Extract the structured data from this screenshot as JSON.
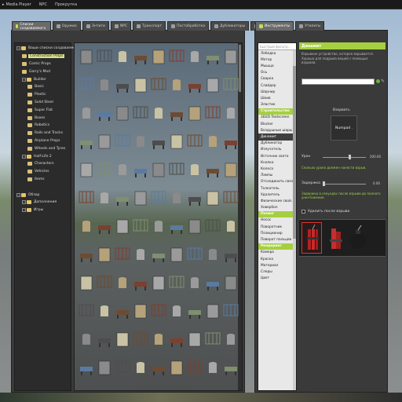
{
  "menubar": {
    "items": [
      "Media Player",
      "NPC",
      "Прокрутка"
    ]
  },
  "spawn_tabs": [
    {
      "label": "Списки создаваемого",
      "active": true
    },
    {
      "label": "Оружие",
      "active": false
    },
    {
      "label": "Энтити",
      "active": false
    },
    {
      "label": "NPC",
      "active": false
    },
    {
      "label": "Транспорт",
      "active": false
    },
    {
      "label": "Постобработка",
      "active": false
    },
    {
      "label": "Дубликаторы",
      "active": false
    },
    {
      "label": "Сохранения",
      "active": false
    }
  ],
  "tree": [
    {
      "label": "Ваши списки создаваемого",
      "indent": 0,
      "type": "folder"
    },
    {
      "label": "Construction Props",
      "indent": 1,
      "type": "file",
      "selected": true
    },
    {
      "label": "Comic Props",
      "indent": 1,
      "type": "file"
    },
    {
      "label": "Garry's Mod",
      "indent": 1,
      "type": "file"
    },
    {
      "label": "Builder",
      "indent": 1,
      "type": "folder"
    },
    {
      "label": "Basic",
      "indent": 2,
      "type": "file"
    },
    {
      "label": "Plastic",
      "indent": 2,
      "type": "file"
    },
    {
      "label": "Solid Steel",
      "indent": 2,
      "type": "file"
    },
    {
      "label": "Super Flat",
      "indent": 2,
      "type": "file"
    },
    {
      "label": "Boxes",
      "indent": 2,
      "type": "file"
    },
    {
      "label": "Robotics",
      "indent": 2,
      "type": "file"
    },
    {
      "label": "Rails and Tracks",
      "indent": 2,
      "type": "file"
    },
    {
      "label": "Airplane Props",
      "indent": 2,
      "type": "file"
    },
    {
      "label": "Wheels and Tyres",
      "indent": 2,
      "type": "file"
    },
    {
      "label": "Half-Life 2",
      "indent": 1,
      "type": "folder"
    },
    {
      "label": "Characters",
      "indent": 2,
      "type": "file"
    },
    {
      "label": "Vehicles",
      "indent": 2,
      "type": "file"
    },
    {
      "label": "Items",
      "indent": 2,
      "type": "file"
    },
    {
      "label": "",
      "indent": 0,
      "type": "blank"
    },
    {
      "label": "Обзор",
      "indent": 0,
      "type": "folder"
    },
    {
      "label": "Дополнения",
      "indent": 1,
      "type": "folder"
    },
    {
      "label": "Игры",
      "indent": 1,
      "type": "folder"
    }
  ],
  "tools_tabs": [
    {
      "label": "Инструменты",
      "active": true
    },
    {
      "label": "Утилиты",
      "active": false
    }
  ],
  "tool_search_placeholder": "Быстрый фильтр...",
  "tools": [
    {
      "label": "Лебедка",
      "kind": "item"
    },
    {
      "label": "Мотор",
      "kind": "item"
    },
    {
      "label": "Мышца",
      "kind": "item"
    },
    {
      "label": "Ось",
      "kind": "item"
    },
    {
      "label": "Сварка",
      "kind": "item"
    },
    {
      "label": "Слайдер",
      "kind": "item"
    },
    {
      "label": "Шарнир",
      "kind": "item"
    },
    {
      "label": "Шкив",
      "kind": "item"
    },
    {
      "label": "Эластик",
      "kind": "item"
    },
    {
      "label": "Строительство",
      "kind": "cat"
    },
    {
      "label": "3D2D Textscreen",
      "kind": "item"
    },
    {
      "label": "Blocker",
      "kind": "item"
    },
    {
      "label": "Воздушные шары",
      "kind": "item"
    },
    {
      "label": "Динамит",
      "kind": "sel"
    },
    {
      "label": "Дубликатор",
      "kind": "item"
    },
    {
      "label": "Излучатель",
      "kind": "item"
    },
    {
      "label": "Источник света",
      "kind": "item"
    },
    {
      "label": "Кнопка",
      "kind": "item"
    },
    {
      "label": "Колеса",
      "kind": "item"
    },
    {
      "label": "Лампы",
      "kind": "item"
    },
    {
      "label": "Отсоединить связи",
      "kind": "item"
    },
    {
      "label": "Толкатель",
      "kind": "item"
    },
    {
      "label": "Удалитель",
      "kind": "item"
    },
    {
      "label": "Физические свой...",
      "kind": "item"
    },
    {
      "label": "Ховербол",
      "kind": "item"
    },
    {
      "label": "Позинг",
      "kind": "cat"
    },
    {
      "label": "Носос",
      "kind": "item"
    },
    {
      "label": "Поворотник",
      "kind": "item"
    },
    {
      "label": "Позиционир",
      "kind": "item"
    },
    {
      "label": "Поворот пальцев",
      "kind": "item"
    },
    {
      "label": "Рендеринг",
      "kind": "cat"
    },
    {
      "label": "Камера",
      "kind": "item"
    },
    {
      "label": "Краска",
      "kind": "item"
    },
    {
      "label": "Материал",
      "kind": "item"
    },
    {
      "label": "Следы",
      "kind": "item"
    },
    {
      "label": "Цвет",
      "kind": "item"
    }
  ],
  "tool_panel": {
    "title": "Динамит",
    "description": "Взрывное устройство, которое взрывается. Хорошо для подрыва вещей с помощью взрывов.",
    "detonate_label": "Взорвать",
    "numpad_label": "Numpad .",
    "damage_label": "Урон",
    "damage_value": "200.00",
    "damage_fraction": 0.6,
    "damage_help": "Сколько урона должен нанести взрыв.",
    "delay_label": "Задержка",
    "delay_value": "0.00",
    "delay_fraction": 0.0,
    "delay_help": "Задержка в секундах после взрыва до полного уничтожения.",
    "remove_label": "Удалить после взрыва"
  }
}
